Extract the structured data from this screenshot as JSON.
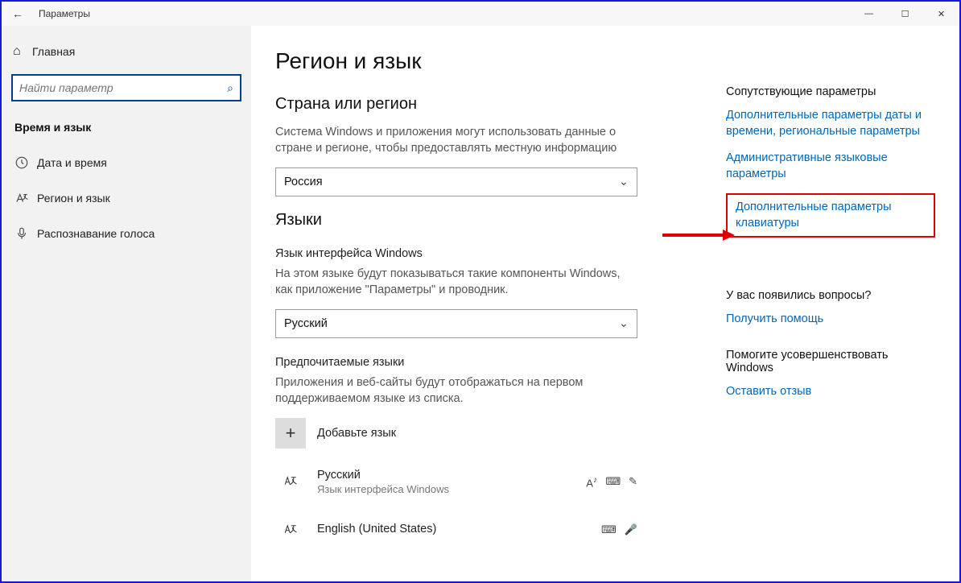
{
  "titlebar": {
    "back": "←",
    "title": "Параметры"
  },
  "sidebar": {
    "home": "Главная",
    "search_placeholder": "Найти параметр",
    "group": "Время и язык",
    "items": [
      {
        "label": "Дата и время"
      },
      {
        "label": "Регион и язык"
      },
      {
        "label": "Распознавание голоса"
      }
    ]
  },
  "main": {
    "title": "Регион и язык",
    "section_region": {
      "heading": "Страна или регион",
      "desc": "Система Windows и приложения могут использовать данные о стране и регионе, чтобы предоставлять местную информацию",
      "selected": "Россия"
    },
    "section_lang": {
      "heading": "Языки",
      "ui_label": "Язык интерфейса Windows",
      "ui_desc": "На этом языке будут показываться такие компоненты Windows, как приложение \"Параметры\" и проводник.",
      "ui_selected": "Русский",
      "pref_label": "Предпочитаемые языки",
      "pref_desc": "Приложения и веб-сайты будут отображаться на первом поддерживаемом языке из списка.",
      "add": "Добавьте язык",
      "langs": [
        {
          "name": "Русский",
          "sub": "Язык интерфейса Windows"
        },
        {
          "name": "English (United States)",
          "sub": ""
        }
      ]
    }
  },
  "aside": {
    "related_heading": "Сопутствующие параметры",
    "links": [
      "Дополнительные параметры даты и времени, региональные параметры",
      "Административные языковые параметры",
      "Дополнительные параметры клавиатуры"
    ],
    "q_heading": "У вас появились вопросы?",
    "q_link": "Получить помощь",
    "improve_heading": "Помогите усовершенствовать Windows",
    "improve_link": "Оставить отзыв"
  }
}
